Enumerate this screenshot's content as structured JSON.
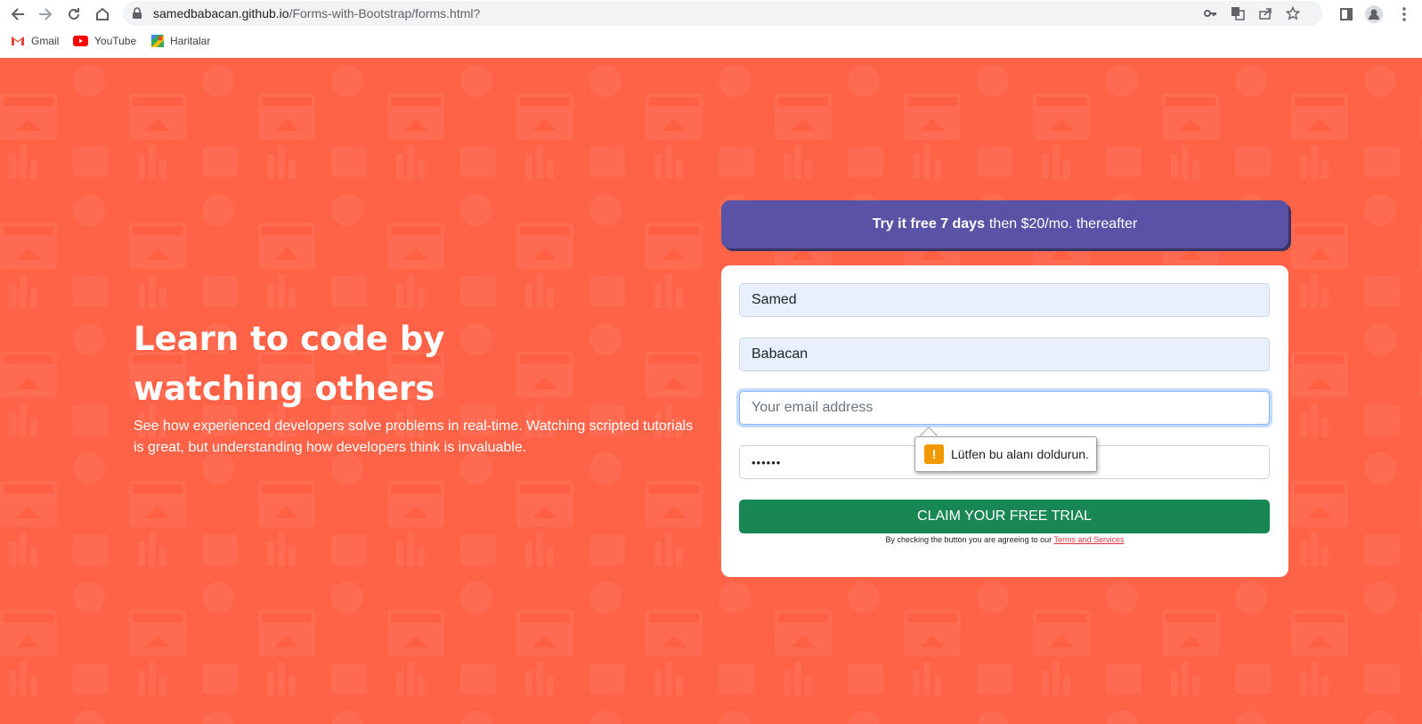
{
  "browser": {
    "url_host": "samedbabacan.github.io",
    "url_path": "/Forms-with-Bootstrap/forms.html?",
    "bookmarks": [
      {
        "label": "Gmail",
        "icon": "gmail-icon"
      },
      {
        "label": "YouTube",
        "icon": "youtube-icon"
      },
      {
        "label": "Haritalar",
        "icon": "maps-icon"
      }
    ]
  },
  "hero": {
    "title": "Learn to code by watching others",
    "description": "See how experienced developers solve problems in real-time. Watching scripted tutorials is great, but understanding how developers think is invaluable."
  },
  "banner": {
    "bold": "Try it free 7 days",
    "rest": "then $20/mo. thereafter"
  },
  "form": {
    "first_name_value": "Samed",
    "last_name_value": "Babacan",
    "email_placeholder": "Your email address",
    "password_value": "••••••",
    "submit_label": "CLAIM YOUR FREE TRIAL",
    "terms_text": "By checking the button you are agreeing to our",
    "terms_link": "Terms and Services"
  },
  "validation": {
    "message": "Lütfen bu alanı doldurun."
  },
  "colors": {
    "page_bg": "#ff6347",
    "banner_bg": "#5a52a4",
    "button_bg": "#198754"
  }
}
